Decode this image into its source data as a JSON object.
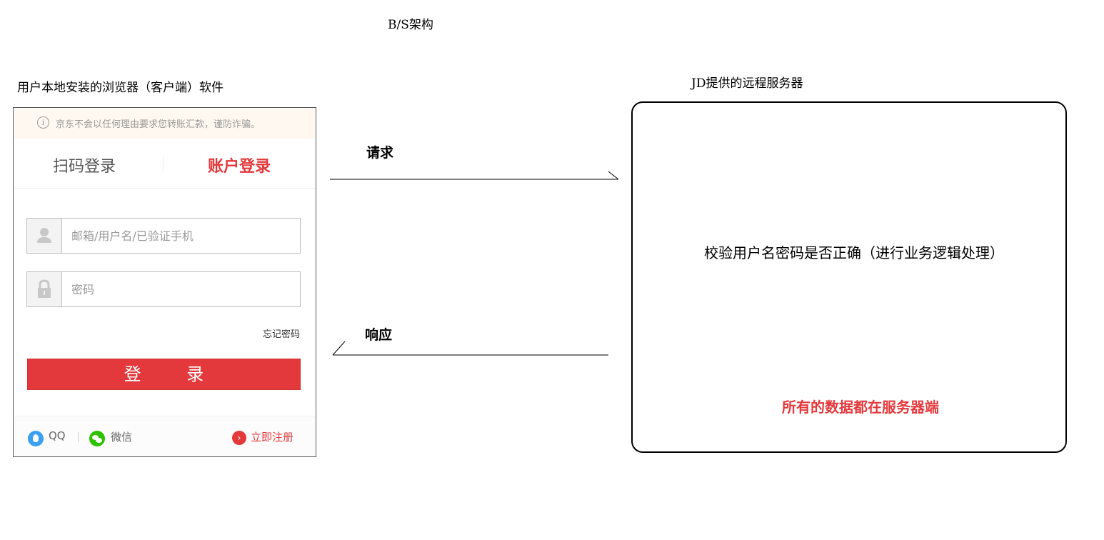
{
  "diagram_title": "B/S架构",
  "client": {
    "label": "用户本地安装的浏览器（客户端）软件",
    "login": {
      "notice": "京东不会以任何理由要求您转账汇款，谨防诈骗。",
      "notice_icon": "info-icon",
      "tabs": [
        "扫码登录",
        "账户登录"
      ],
      "active_tab": "账户登录",
      "username_placeholder": "邮箱/用户名/已验证手机",
      "password_placeholder": "密码",
      "forgot_password": "忘记密码",
      "login_button": "登 录",
      "footer": {
        "qq": "QQ",
        "wechat": "微信",
        "register": "立即注册"
      },
      "accent_color": "#e4393c"
    }
  },
  "arrows": {
    "request_label": "请求",
    "response_label": "响应"
  },
  "server": {
    "label": "JD提供的远程服务器",
    "task": "校验用户名密码是否正确（进行业务逻辑处理）",
    "note": "所有的数据都在服务器端",
    "note_color": "#e4393c"
  }
}
